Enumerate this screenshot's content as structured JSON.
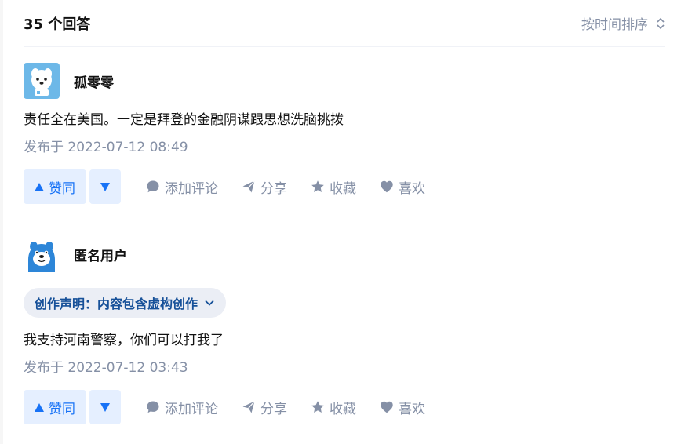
{
  "header": {
    "count_label": "35 个回答",
    "sort_label": "按时间排序"
  },
  "answers": [
    {
      "author": "孤零零",
      "avatar_icon": "dog-avatar-icon",
      "content": "责任全在美国。一定是拜登的金融阴谋跟思想洗脑挑拨",
      "time": "发布于 2022-07-12 08:49",
      "vote_up_label": "赞同",
      "comment_label": "添加评论",
      "share_label": "分享",
      "collect_label": "收藏",
      "like_label": "喜欢"
    },
    {
      "author": "匿名用户",
      "avatar_icon": "anonymous-avatar-icon",
      "declaration": "创作声明：内容包含虚构创作",
      "content": "我支持河南警察，你们可以打我了",
      "time": "发布于 2022-07-12 03:43",
      "vote_up_label": "赞同",
      "comment_label": "添加评论",
      "share_label": "分享",
      "collect_label": "收藏",
      "like_label": "喜欢"
    }
  ],
  "colors": {
    "accent": "#1772f6",
    "vote_bg": "#e5efff",
    "muted": "#8590a6",
    "declaration_text": "#175199",
    "declaration_bg": "#ebeef5"
  }
}
